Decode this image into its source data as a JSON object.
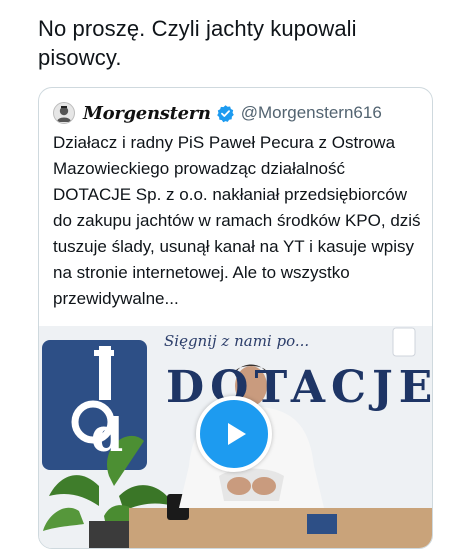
{
  "tweet": {
    "text": "No proszę. Czyli jachty kupowali pisowcy."
  },
  "quote": {
    "display_name": "Morgenstern",
    "handle": "@Morgenstern616",
    "text": "Działacz i radny PiS Paweł Pecura z Ostrowa Mazowieckiego prowadząc działalność DOTACJE Sp. z o.o. nakłaniał przedsiębiorców do zakupu jachtów w ramach środków KPO, dziś tuszuje ślady, usunął kanał na YT i kasuje wpisy na stronie internetowej. Ale to wszystko przewidywalne..."
  },
  "video": {
    "slogan": "Sięgnij z nami po...",
    "sign_text": "DOTACJE",
    "logo_letter": "d"
  },
  "colors": {
    "accent": "#1d9bf0",
    "text": "#0f1419",
    "secondary_text": "#536471",
    "border": "#cfd9de",
    "brand_navy": "#1e3565"
  }
}
